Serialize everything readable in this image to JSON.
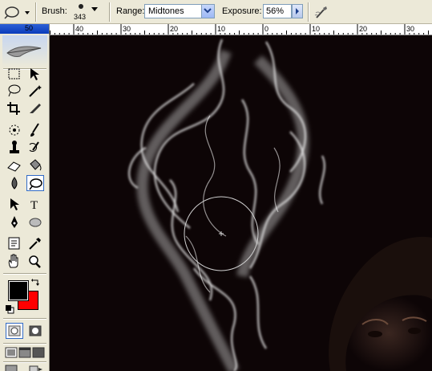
{
  "options_bar": {
    "brush_label": "Brush:",
    "brush_size": "343",
    "range_label": "Range:",
    "range_value": "Midtones",
    "exposure_label": "Exposure:",
    "exposure_value": "56%"
  },
  "ruler": {
    "partial_left_label": "50",
    "labels": [
      "40",
      "30",
      "20",
      "10",
      "0",
      "10",
      "20",
      "30"
    ]
  },
  "colors": {
    "foreground": "#000000",
    "background": "#ff0000",
    "canvas_bg": "#0d0506"
  },
  "toolbox": {
    "tools": [
      "marquee-tool",
      "move-tool",
      "lasso-tool",
      "magic-wand-tool",
      "crop-tool",
      "slice-tool",
      "healing-brush-tool",
      "brush-tool",
      "clone-stamp-tool",
      "history-brush-tool",
      "eraser-tool",
      "paint-bucket-tool",
      "blur-tool",
      "dodge-tool",
      "path-selection-tool",
      "type-tool",
      "pen-tool",
      "shape-tool",
      "notes-tool",
      "eyedropper-tool",
      "hand-tool",
      "zoom-tool"
    ],
    "active_tool": "dodge-tool"
  }
}
